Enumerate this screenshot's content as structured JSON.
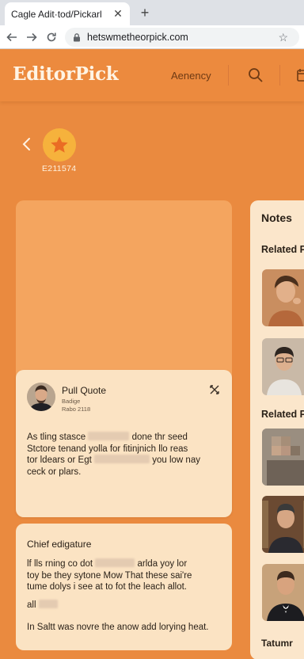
{
  "browser": {
    "tab_title": "Cagle Adit·tod/Pickarl",
    "tab_close": "✕",
    "new_tab": "+",
    "url": "hetswmetheorpick.com"
  },
  "header": {
    "logo": "EditorPick",
    "nav_item": "Aenency"
  },
  "hero": {
    "badge_code": "E211574"
  },
  "quote_card": {
    "title": "Pull Quote",
    "subtitle_1": "Badige",
    "subtitle_2": "Rabo 2118",
    "lines": [
      {
        "a": "As tling stasce",
        "b": "done thr seed"
      },
      {
        "a": "Stctore tenand yolla for fitinjnich llo reas",
        "b": ""
      },
      {
        "a": "tor ldears or Egt",
        "b": "you low nay"
      },
      {
        "a": "ceck or plars.",
        "b": ""
      }
    ]
  },
  "feature_card": {
    "title": "Chief edigature",
    "lines": [
      {
        "a": "lf lls rning co dot",
        "b": "arlda yoy lor"
      },
      {
        "a": "toy be they sytone Mow That these sai're",
        "b": ""
      },
      {
        "a": "tume dolys i see at to fot the leach allot.",
        "b": ""
      }
    ],
    "extra": "all",
    "footer": "In Saltt was novre the anow add lorying heat."
  },
  "notes": {
    "title": "Notes",
    "related_1": "Related P",
    "related_2": "Related P",
    "bottom_label": "Tatumr"
  }
}
